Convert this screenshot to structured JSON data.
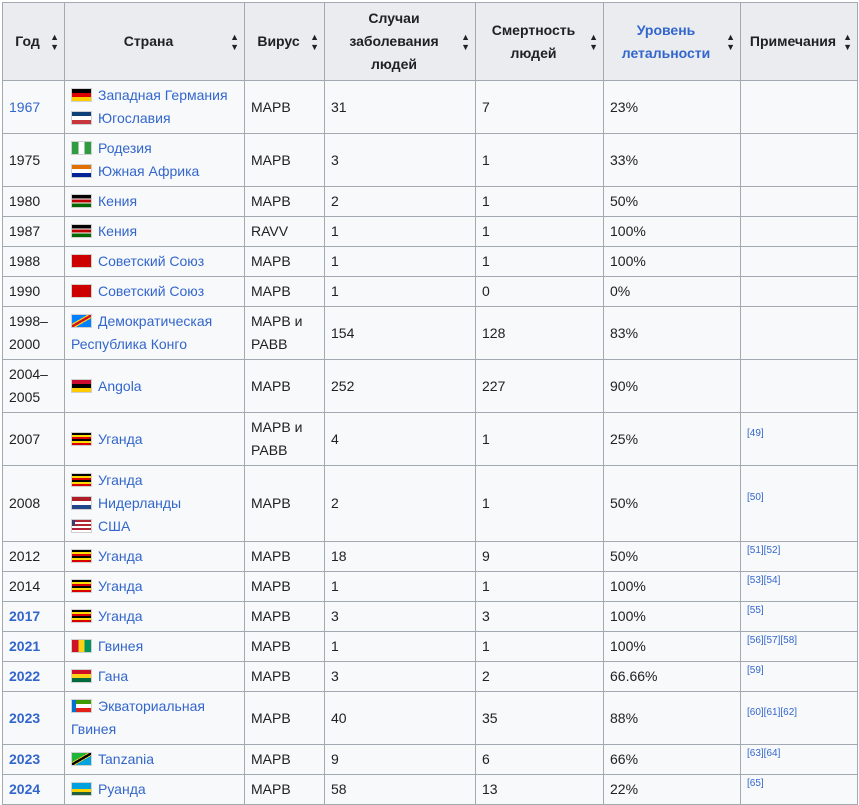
{
  "headers": {
    "year": "Год",
    "country": "Страна",
    "virus": "Вирус",
    "cases": "Случаи заболевания людей",
    "deaths": "Смертность людей",
    "fatality": "Уровень летальности",
    "notes": "Примечания",
    "sort_icon": "sort-arrows-icon"
  },
  "flag_colors": {
    "germany": [
      "#000000",
      "#dd0000",
      "#ffce00"
    ],
    "yugoslavia": [
      "#0c4076",
      "#ffffff",
      "#c6363c"
    ],
    "rhodesia": [
      "#319b42",
      "#ffffff",
      "#319b42"
    ],
    "south_africa": [
      "#e07000",
      "#ffffff",
      "#002395"
    ],
    "kenya": [
      "#000000",
      "#bb0000",
      "#006600"
    ],
    "soviet": [
      "#cc0000"
    ],
    "drc": [
      "#007fff",
      "#ce1021",
      "#f7d618"
    ],
    "angola": [
      "#cc092f",
      "#000000",
      "#ffcb00"
    ],
    "uganda": [
      "#000000",
      "#fcdc04",
      "#d90000"
    ],
    "netherlands": [
      "#ae1c28",
      "#ffffff",
      "#21468b"
    ],
    "usa": [
      "#b22234",
      "#ffffff",
      "#3c3b6e"
    ],
    "guinea": [
      "#ce1126",
      "#fcd116",
      "#009460"
    ],
    "ghana": [
      "#ce1126",
      "#fcd116",
      "#006b3f"
    ],
    "equatorial_guinea": [
      "#3e9a00",
      "#ffffff",
      "#e32118",
      "#0073ce"
    ],
    "tanzania": [
      "#1eb53a",
      "#000000",
      "#00a3dd",
      "#fcd116"
    ],
    "rwanda": [
      "#20603d",
      "#fad201",
      "#00a1de"
    ]
  },
  "rows": [
    {
      "year": "1967",
      "year_style": "link",
      "countries": [
        {
          "flag": "germany",
          "name": "Западная Германия"
        },
        {
          "flag": "yugoslavia",
          "name": "Югославия"
        }
      ],
      "virus": [
        "МАРВ"
      ],
      "cases": "31",
      "deaths": "7",
      "fatality": "23%",
      "notes": ""
    },
    {
      "year": "1975",
      "year_style": "plain",
      "countries": [
        {
          "flag": "rhodesia",
          "name": "Родезия"
        },
        {
          "flag": "south_africa",
          "name": "Южная Африка"
        }
      ],
      "virus": [
        "МАРВ"
      ],
      "cases": "3",
      "deaths": "1",
      "fatality": "33%",
      "notes": ""
    },
    {
      "year": "1980",
      "year_style": "plain",
      "countries": [
        {
          "flag": "kenya",
          "name": "Кения"
        }
      ],
      "virus": [
        "МАРВ"
      ],
      "cases": "2",
      "deaths": "1",
      "fatality": "50%",
      "notes": ""
    },
    {
      "year": "1987",
      "year_style": "plain",
      "countries": [
        {
          "flag": "kenya",
          "name": "Кения"
        }
      ],
      "virus": [
        "RAVV"
      ],
      "cases": "1",
      "deaths": "1",
      "fatality": "100%",
      "notes": ""
    },
    {
      "year": "1988",
      "year_style": "plain",
      "countries": [
        {
          "flag": "soviet",
          "name": "Советский Союз"
        }
      ],
      "virus": [
        "МАРВ"
      ],
      "cases": "1",
      "deaths": "1",
      "fatality": "100%",
      "notes": ""
    },
    {
      "year": "1990",
      "year_style": "plain",
      "countries": [
        {
          "flag": "soviet",
          "name": "Советский Союз"
        }
      ],
      "virus": [
        "МАРВ"
      ],
      "cases": "1",
      "deaths": "0",
      "fatality": "0%",
      "notes": ""
    },
    {
      "year_lines": [
        "1998–",
        "2000"
      ],
      "year_style": "plain",
      "country_wrapped": {
        "flag": "drc",
        "lines": [
          "Демократическая",
          "Республика Конго"
        ]
      },
      "virus": [
        "МАРВ и",
        "РАВВ"
      ],
      "cases": "154",
      "deaths": "128",
      "fatality": "83%",
      "notes": ""
    },
    {
      "year_lines": [
        "2004–",
        "2005"
      ],
      "year_style": "plain",
      "countries": [
        {
          "flag": "angola",
          "name": "Angola"
        }
      ],
      "virus": [
        "МАРВ"
      ],
      "cases": "252",
      "deaths": "227",
      "fatality": "90%",
      "notes": ""
    },
    {
      "year": "2007",
      "year_style": "plain",
      "countries": [
        {
          "flag": "uganda",
          "name": "Уганда"
        }
      ],
      "virus": [
        "МАРВ и",
        "РАВВ"
      ],
      "cases": "4",
      "deaths": "1",
      "fatality": "25%",
      "notes": "[49]"
    },
    {
      "year": "2008",
      "year_style": "plain",
      "countries": [
        {
          "flag": "uganda",
          "name": "Уганда"
        },
        {
          "flag": "netherlands",
          "name": "Нидерланды"
        },
        {
          "flag": "usa",
          "name": "США"
        }
      ],
      "virus": [
        "МАРВ"
      ],
      "cases": "2",
      "deaths": "1",
      "fatality": "50%",
      "notes": "[50]"
    },
    {
      "year": "2012",
      "year_style": "plain",
      "countries": [
        {
          "flag": "uganda",
          "name": "Уганда"
        }
      ],
      "virus": [
        "МАРВ"
      ],
      "cases": "18",
      "deaths": "9",
      "fatality": "50%",
      "notes": "[51][52]"
    },
    {
      "year": "2014",
      "year_style": "plain",
      "countries": [
        {
          "flag": "uganda",
          "name": "Уганда"
        }
      ],
      "virus": [
        "МАРВ"
      ],
      "cases": "1",
      "deaths": "1",
      "fatality": "100%",
      "notes": "[53][54]"
    },
    {
      "year": "2017",
      "year_style": "bold",
      "countries": [
        {
          "flag": "uganda",
          "name": "Уганда"
        }
      ],
      "virus": [
        "МАРВ"
      ],
      "cases": "3",
      "deaths": "3",
      "fatality": "100%",
      "notes": "[55]"
    },
    {
      "year": "2021",
      "year_style": "bold",
      "countries": [
        {
          "flag": "guinea",
          "name": "Гвинея"
        }
      ],
      "virus": [
        "МАРВ"
      ],
      "cases": "1",
      "deaths": "1",
      "fatality": "100%",
      "notes": "[56][57][58]"
    },
    {
      "year": "2022",
      "year_style": "bold",
      "countries": [
        {
          "flag": "ghana",
          "name": "Гана"
        }
      ],
      "virus": [
        "МАРВ"
      ],
      "cases": "3",
      "deaths": "2",
      "fatality": "66.66%",
      "notes": "[59]"
    },
    {
      "year": "2023",
      "year_style": "bold",
      "country_wrapped": {
        "flag": "equatorial_guinea",
        "lines": [
          "Экваториальная",
          "Гвинея"
        ]
      },
      "virus": [
        "МАРВ"
      ],
      "cases": "40",
      "deaths": "35",
      "fatality": "88%",
      "notes": "[60][61][62]"
    },
    {
      "year": "2023",
      "year_style": "bold",
      "countries": [
        {
          "flag": "tanzania",
          "name": "Tanzania"
        }
      ],
      "virus": [
        "МАРВ"
      ],
      "cases": "9",
      "deaths": "6",
      "fatality": "66%",
      "notes": "[63][64]"
    },
    {
      "year": "2024",
      "year_style": "bold",
      "countries": [
        {
          "flag": "rwanda",
          "name": "Руанда"
        }
      ],
      "virus": [
        "МАРВ"
      ],
      "cases": "58",
      "deaths": "13",
      "fatality": "22%",
      "notes": "[65]"
    }
  ]
}
